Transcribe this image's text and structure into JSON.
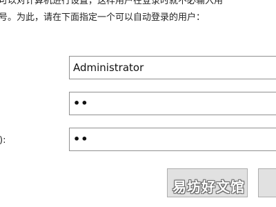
{
  "description": {
    "line1": "可以对计算机进行设置，这样用户在登录时就不必输入用",
    "line2": "号。为此，请在下面指定一个可以自动登录的用户："
  },
  "form": {
    "username_value": "Administrator",
    "password_value": "••",
    "confirm_label": "):",
    "confirm_value": "••"
  },
  "watermark": {
    "text": "易坊好文馆"
  }
}
